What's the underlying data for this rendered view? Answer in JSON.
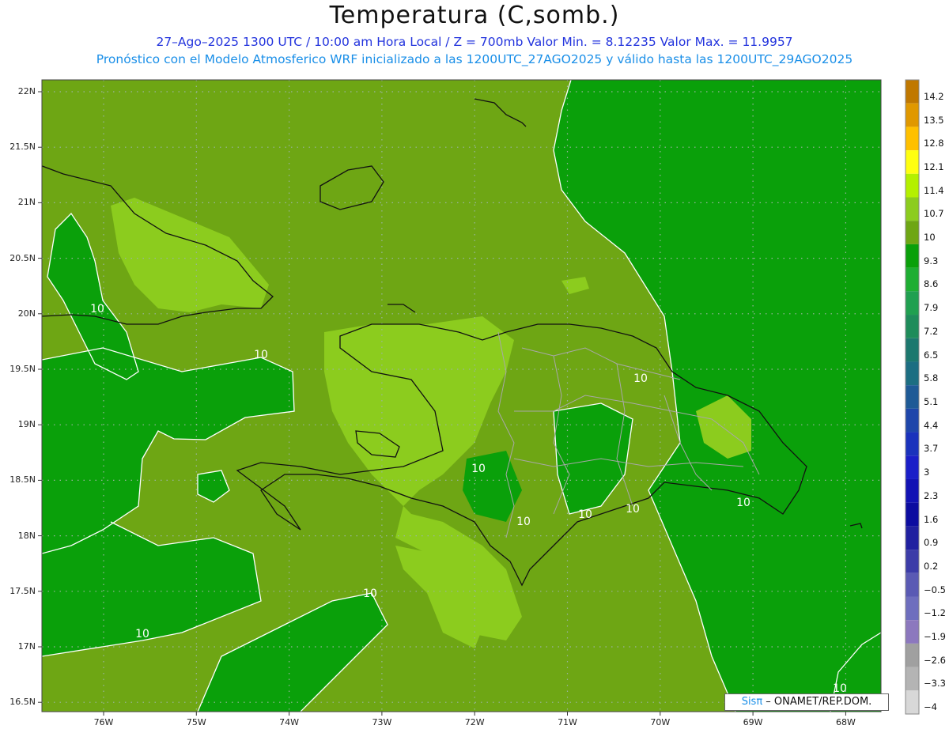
{
  "header": {
    "title": "Temperatura (C,somb.)",
    "subtitle_1": "27–Ago–2025  1300 UTC / 10:00 am Hora Local / Z = 700mb    Valor Min. = 8.12235  Valor Max. = 11.9957",
    "subtitle_2": "Pronóstico con el Modelo Atmosferico WRF inicializado a las 1200UTC_27AGO2025 y válido hasta las  1200UTC_29AGO2025"
  },
  "axes": {
    "y_ticks": [
      "22N",
      "21.5N",
      "21N",
      "20.5N",
      "20N",
      "19.5N",
      "19N",
      "18.5N",
      "18N",
      "17.5N",
      "17N",
      "16.5N"
    ],
    "x_ticks": [
      "76W",
      "75W",
      "74W",
      "73W",
      "72W",
      "71W",
      "70W",
      "69W",
      "68W"
    ]
  },
  "contour_labels": [
    "10",
    "10",
    "10",
    "10",
    "10",
    "10",
    "10",
    "10",
    "10",
    "10",
    "10"
  ],
  "legend": {
    "levels": [
      "14.2",
      "13.5",
      "12.8",
      "12.1",
      "11.4",
      "10.7",
      "10",
      "9.3",
      "8.6",
      "7.9",
      "7.2",
      "6.5",
      "5.8",
      "5.1",
      "4.4",
      "3.7",
      "3",
      "2.3",
      "1.6",
      "0.9",
      "0.2",
      "−0.5",
      "−1.2",
      "−1.9",
      "−2.6",
      "−3.3",
      "−4"
    ],
    "colors": [
      "#c07800",
      "#e09800",
      "#ffc000",
      "#ffff10",
      "#b4f000",
      "#8ccc1e",
      "#6ea614",
      "#0aa00a",
      "#1eae32",
      "#20a050",
      "#1e8c5a",
      "#1c786e",
      "#1c6e82",
      "#1e5a96",
      "#1e46aa",
      "#1a32bc",
      "#1a1ec8",
      "#1212b4",
      "#0c0ca0",
      "#2020a0",
      "#3c3ca8",
      "#5a5ab4",
      "#6e6ebe",
      "#8c78be",
      "#a0a0a0",
      "#b4b4b4",
      "#d8d8d8"
    ]
  },
  "map_colors": {
    "background": "#6ea614",
    "cool_region": "#0aa00a",
    "warm_region": "#8ccc1e",
    "contour": "#ffffff",
    "coastline": "#111111",
    "provinces": "#a8a8a8",
    "grid": "#9ab4a0"
  },
  "credit": {
    "sis": "Sisπ",
    "text": " – ONAMET/REP.DOM."
  }
}
